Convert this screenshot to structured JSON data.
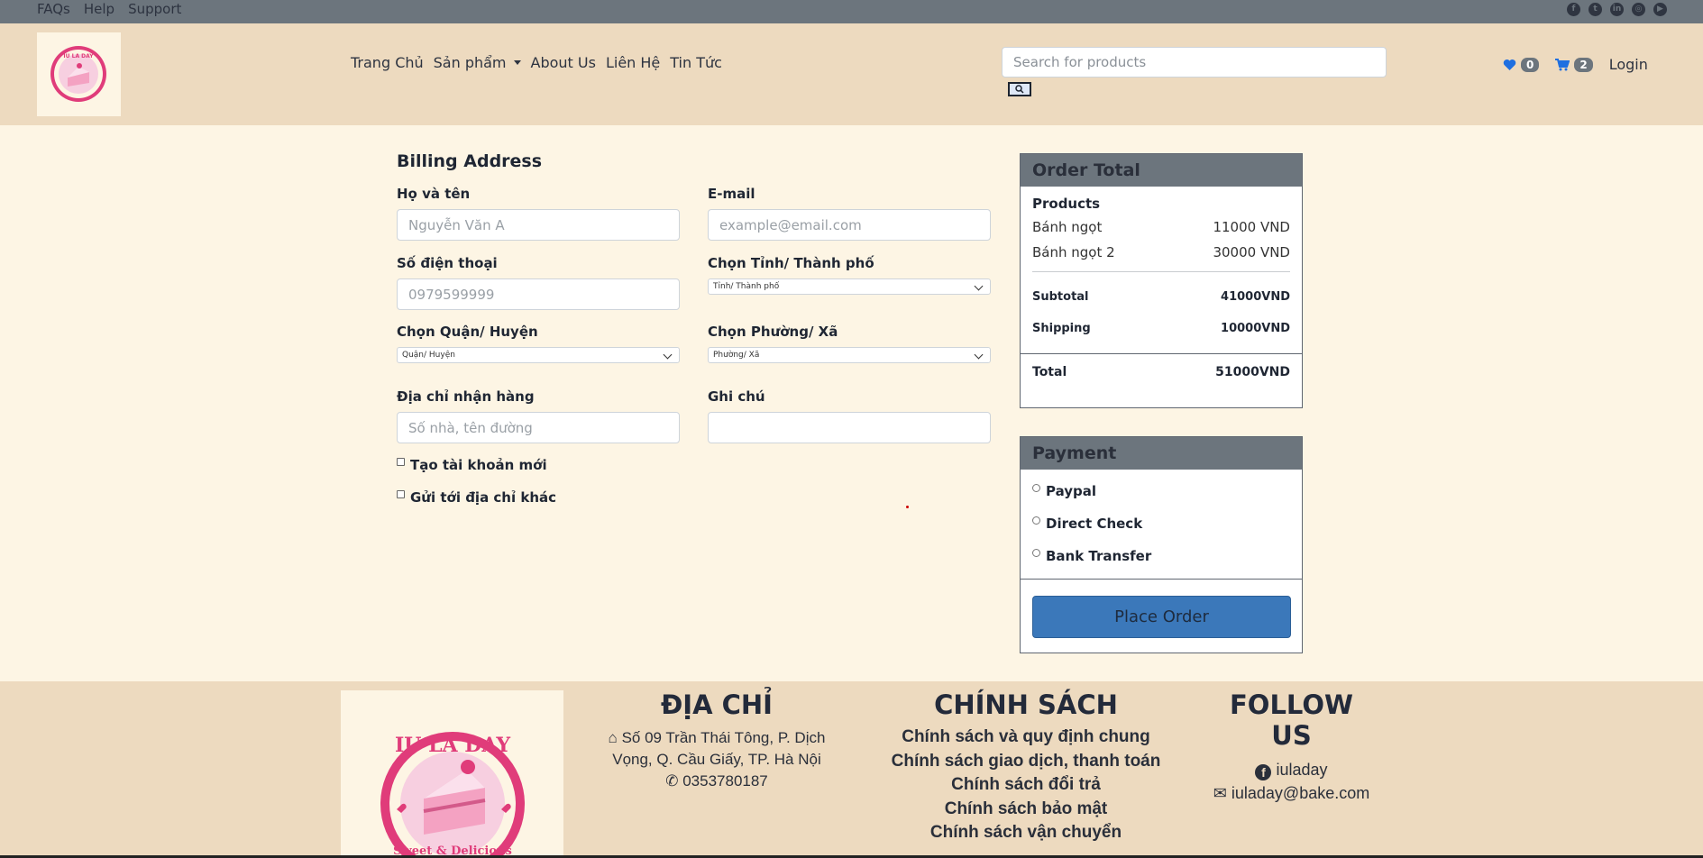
{
  "topbar": {
    "links": [
      "FAQs",
      "Help",
      "Support"
    ],
    "social_icons": [
      "facebook-icon",
      "twitter-icon",
      "linkedin-icon",
      "instagram-icon",
      "youtube-icon"
    ]
  },
  "header": {
    "logo_text": "IU LA DAY",
    "nav": {
      "home": "Trang Chủ",
      "products": "Sản phẩm",
      "about": "About Us",
      "contact": "Liên Hệ",
      "news": "Tin Tức"
    },
    "search": {
      "placeholder": "Search for products"
    },
    "wishlist_count": "0",
    "cart_count": "2",
    "login": "Login"
  },
  "billing": {
    "title": "Billing Address",
    "fullname": {
      "label": "Họ và tên",
      "placeholder": "Nguyễn Văn A"
    },
    "email": {
      "label": "E-mail",
      "placeholder": "example@email.com"
    },
    "phone": {
      "label": "Số điện thoại",
      "placeholder": "0979599999"
    },
    "province": {
      "label": "Chọn Tỉnh/ Thành phố",
      "value": "Tỉnh/ Thành phố"
    },
    "district": {
      "label": "Chọn Quận/ Huyện",
      "value": "Quận/ Huyện"
    },
    "ward": {
      "label": "Chọn Phường/ Xã",
      "value": "Phường/ Xã"
    },
    "address": {
      "label": "Địa chỉ nhận hàng",
      "placeholder": "Số nhà, tên đường"
    },
    "note": {
      "label": "Ghi chú",
      "placeholder": ""
    },
    "create_account": "Tạo tài khoản mới",
    "ship_other": "Gửi tới địa chỉ khác"
  },
  "order": {
    "title": "Order Total",
    "products_label": "Products",
    "items": [
      {
        "name": "Bánh ngọt",
        "price": "11000 VND"
      },
      {
        "name": "Bánh ngọt 2",
        "price": "30000 VND"
      }
    ],
    "subtotal_label": "Subtotal",
    "subtotal": "41000VND",
    "shipping_label": "Shipping",
    "shipping": "10000VND",
    "total_label": "Total",
    "total": "51000VND"
  },
  "payment": {
    "title": "Payment",
    "options": [
      "Paypal",
      "Direct Check",
      "Bank Transfer"
    ],
    "place_order": "Place Order"
  },
  "footer": {
    "address_title": "ĐỊA CHỈ",
    "address_line1": "Số 09 Trần Thái Tông, P. Dịch",
    "address_line2": "Vọng, Q. Cầu Giấy, TP. Hà Nội",
    "phone": "0353780187",
    "policy_title": "CHÍNH SÁCH",
    "policies": [
      "Chính sách và quy định chung",
      "Chính sách giao dịch, thanh toán",
      "Chính sách đổi trả",
      "Chính sách bảo mật",
      "Chính sách vận chuyển"
    ],
    "follow_title_1": "FOLLOW",
    "follow_title_2": "US",
    "facebook": "iuladay",
    "email": "iuladay@bake.com",
    "logo_text": "IU LA DAY",
    "logo_sub": "Sweet & Delicious"
  },
  "colors": {
    "topbar": "#6c757d",
    "header": "#eddabf",
    "body": "#fdf5e4",
    "accent_pink": "#e03c7a",
    "button": "#3b78ba"
  }
}
